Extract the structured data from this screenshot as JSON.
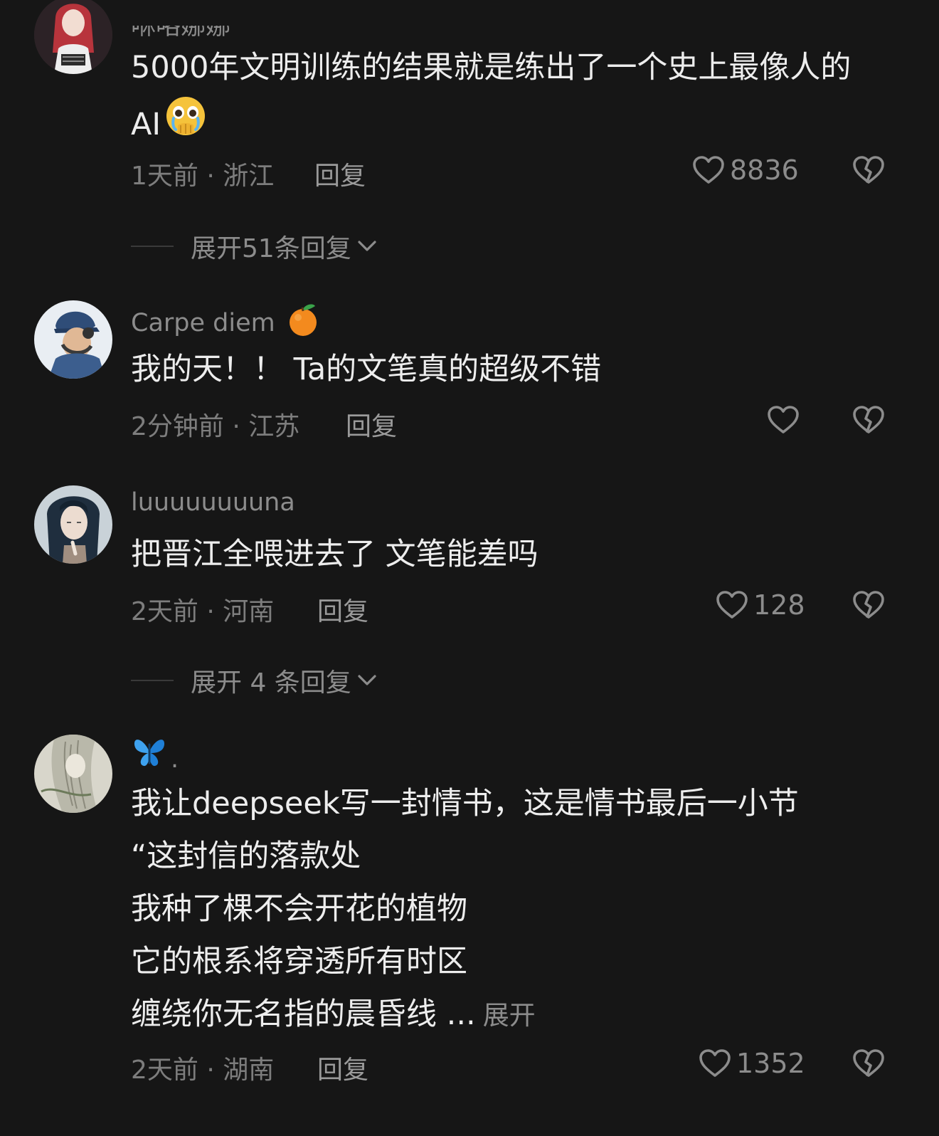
{
  "comments": [
    {
      "username": "咻咯娜娜",
      "content_lines": [
        "5000年文明训练的结果就是练出了一个史上最像人的",
        "AI"
      ],
      "meta": "1天前 · 浙江",
      "reply_label": "回复",
      "likes": "8836",
      "expand_label": "展开51条回复"
    },
    {
      "username": "Carpe diem",
      "content_lines": [
        "我的天！！ Ta的文笔真的超级不错"
      ],
      "meta": "2分钟前 · 江苏",
      "reply_label": "回复",
      "likes": ""
    },
    {
      "username": "luuuuuuuuna",
      "content_lines": [
        "把晋江全喂进去了 文笔能差吗"
      ],
      "meta": "2天前 · 河南",
      "reply_label": "回复",
      "likes": "128",
      "expand_label": "展开 4 条回复"
    },
    {
      "username": ".",
      "content_lines": [
        "我让deepseek写一封情书，这是情书最后一小节",
        "“这封信的落款处",
        "我种了棵不会开花的植物",
        "它的根系将穿透所有时区",
        "缠绕你无名指的晨昏线  ..."
      ],
      "more_label": "展开",
      "meta": "2天前 · 湖南",
      "reply_label": "回复",
      "likes": "1352"
    }
  ],
  "icons": {
    "like": "heart-outline-icon",
    "dislike": "broken-heart-icon",
    "expand": "chevron-down-icon",
    "emoji_cry": "pleading-face-emoji",
    "emoji_orange": "tangerine-emoji",
    "emoji_butterfly": "butterfly-emoji"
  },
  "colors": {
    "background": "#161616",
    "text": "#ededed",
    "secondary": "#8c8c8c"
  }
}
